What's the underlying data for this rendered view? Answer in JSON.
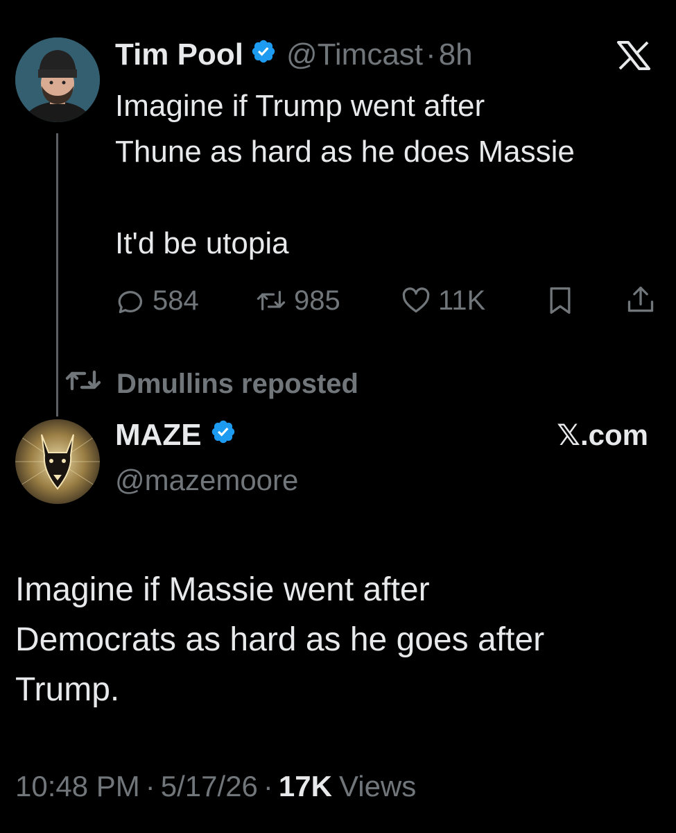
{
  "quoted_tweet": {
    "author_name": "Tim Pool",
    "handle": "@Timcast",
    "separator": "·",
    "time_ago": "8h",
    "platform_logo": "x-logo",
    "text_line1": "Imagine if Trump went after",
    "text_line2": "Thune as hard as he does Massie",
    "text_line3": "It'd be utopia",
    "replies": "584",
    "reposts": "985",
    "likes": "11K",
    "icons": [
      "reply-icon",
      "repost-icon",
      "like-icon",
      "bookmark-icon",
      "share-icon"
    ]
  },
  "repost_banner": {
    "text": "Dmullins reposted"
  },
  "main_tweet": {
    "author_name": "MAZE",
    "handle": "@mazemoore",
    "source": "𝕏.com",
    "text_line1": "Imagine if Massie went after",
    "text_line2": "Democrats as hard as he goes after",
    "text_line3": "Trump.",
    "time": "10:48 PM",
    "sep1": "·",
    "date": "5/17/26",
    "sep2": "·",
    "views_count": "17K",
    "views_label": "Views"
  },
  "colors": {
    "background": "#000000",
    "text": "#e7e9ea",
    "muted": "#71767b",
    "verified": "#1d9bf0"
  }
}
